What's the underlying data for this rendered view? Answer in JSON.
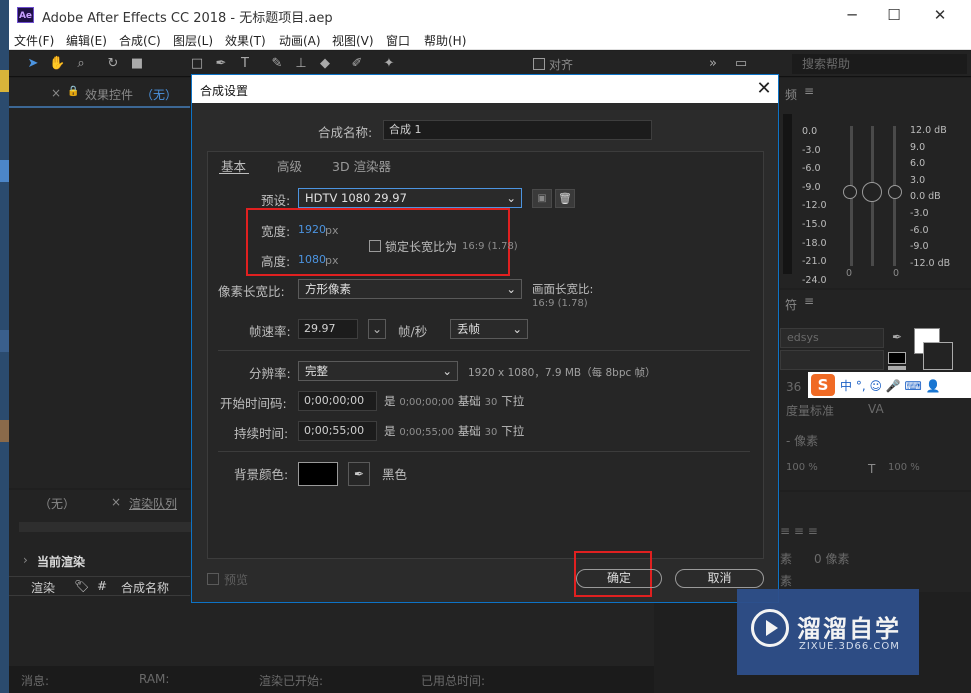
{
  "window": {
    "app_icon": "Ae",
    "title": "Adobe After Effects CC 2018 - 无标题项目.aep",
    "minimize": "─",
    "maximize": "☐",
    "close": "✕"
  },
  "menu": [
    "文件(F)",
    "编辑(E)",
    "合成(C)",
    "图层(L)",
    "效果(T)",
    "动画(A)",
    "视图(V)",
    "窗口",
    "帮助(H)"
  ],
  "toolbar": {
    "align_label": "对齐",
    "search_placeholder": "搜索帮助"
  },
  "left_panel": {
    "effects_tab": "效果控件",
    "effects_paren": "（无）"
  },
  "bottom_panel": {
    "tab_none": "（无）",
    "tab_render_queue": "渲染队列",
    "current_render": "当前渲染",
    "col_render": "渲染",
    "col_hash": "#",
    "col_comp_name": "合成名称",
    "status_msg": "消息:",
    "status_ram": "RAM:",
    "status_started": "渲染已开始:",
    "status_elapsed": "已用总时间:"
  },
  "right_panel": {
    "audio_tab": "频",
    "left_scale": [
      "0.0",
      "-3.0",
      "-6.0",
      "-9.0",
      "-12.0",
      "-15.0",
      "-18.0",
      "-21.0",
      "-24.0"
    ],
    "right_scale": [
      "12.0 dB",
      "9.0",
      "6.0",
      "3.0",
      "0.0 dB",
      "-3.0",
      "-6.0",
      "-9.0",
      "-12.0 dB"
    ],
    "bottom_zero_a": "0",
    "bottom_zero_b": "0",
    "char_tab": "符",
    "font_name": "edsys",
    "size_val": "36",
    "metrics_label": "度量标准",
    "pixels_label": "- 像素",
    "pct_a": "100 %",
    "pct_b": "100 %",
    "para_a": "素",
    "para_b": "0 像素",
    "para_c": "素"
  },
  "ime": {
    "logo": "S",
    "chars": "中 °, ☺ 🎤 ⌨ 👤"
  },
  "dialog": {
    "title": "合成设置",
    "close": "✕",
    "comp_name_label": "合成名称:",
    "comp_name_value": "合成 1",
    "tabs": [
      "基本",
      "高级",
      "3D 渲染器"
    ],
    "preset_label": "预设:",
    "preset_value": "HDTV 1080 29.97",
    "width_label": "宽度:",
    "width_value": "1920",
    "height_label": "高度:",
    "height_value": "1080",
    "unit": "px",
    "lock_label": "锁定长宽比为",
    "lock_ratio": "16:9 (1.78)",
    "pixel_aspect_label": "像素长宽比:",
    "pixel_aspect_value": "方形像素",
    "frame_aspect_label": "画面长宽比:",
    "frame_aspect_value": "16:9 (1.78)",
    "fps_label": "帧速率:",
    "fps_value": "29.97",
    "fps_unit": "帧/秒",
    "drop_frame": "丢帧",
    "resolution_label": "分辨率:",
    "resolution_value": "完整",
    "resolution_info": "1920 x 1080，7.9 MB（每 8bpc 帧）",
    "start_label": "开始时间码:",
    "start_value": "0;00;00;00",
    "start_info_a": "是",
    "start_info_b": "0;00;00;00",
    "start_info_c": "基础",
    "start_info_d": "30",
    "start_info_e": "下拉",
    "duration_label": "持续时间:",
    "duration_value": "0;00;55;00",
    "duration_info_a": "是",
    "duration_info_b": "0;00;55;00",
    "duration_info_c": "基础",
    "duration_info_d": "30",
    "duration_info_e": "下拉",
    "bg_label": "背景颜色:",
    "bg_color_name": "黑色",
    "bg_color": "#000000",
    "preview_label": "预览",
    "ok_label": "确定",
    "cancel_label": "取消"
  },
  "watermark": {
    "brand": "溜溜自学",
    "url": "ZIXUE.3D66.COM"
  },
  "colors": {
    "accent_blue": "#0d73c6",
    "value_blue": "#4c94e0",
    "highlight_red": "#e02020"
  }
}
